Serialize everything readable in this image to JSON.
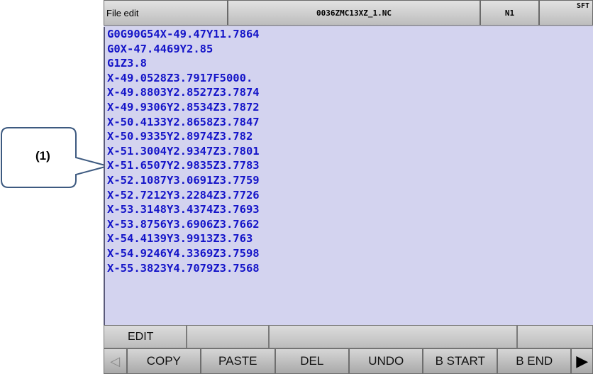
{
  "callout": {
    "label": "(1)"
  },
  "header": {
    "mode": "File edit",
    "filename": "0036ZMC13XZ_1.NC",
    "sequence": "N1",
    "shift": "SFT"
  },
  "editor": {
    "lines": [
      "G0G90G54X-49.47Y11.7864",
      "G0X-47.4469Y2.85",
      "G1Z3.8",
      "X-49.0528Z3.7917F5000.",
      "X-49.8803Y2.8527Z3.7874",
      "X-49.9306Y2.8534Z3.7872",
      "X-50.4133Y2.8658Z3.7847",
      "X-50.9335Y2.8974Z3.782",
      "X-51.3004Y2.9347Z3.7801",
      "X-51.6507Y2.9835Z3.7783",
      "X-52.1087Y3.0691Z3.7759",
      "X-52.7212Y3.2284Z3.7726",
      "X-53.3148Y3.4374Z3.7693",
      "X-53.8756Y3.6906Z3.7662",
      "X-54.4139Y3.9913Z3.763",
      "X-54.9246Y4.3369Z3.7598",
      "X-55.3823Y4.7079Z3.7568"
    ]
  },
  "status": {
    "mode": "EDIT",
    "field2": "",
    "field3": "",
    "field4": ""
  },
  "softkeys": {
    "left_arrow": "◁",
    "copy": "COPY",
    "paste": "PASTE",
    "del": "DEL",
    "undo": "UNDO",
    "b_start": "B START",
    "b_end": "B END",
    "right_arrow": "▶"
  }
}
